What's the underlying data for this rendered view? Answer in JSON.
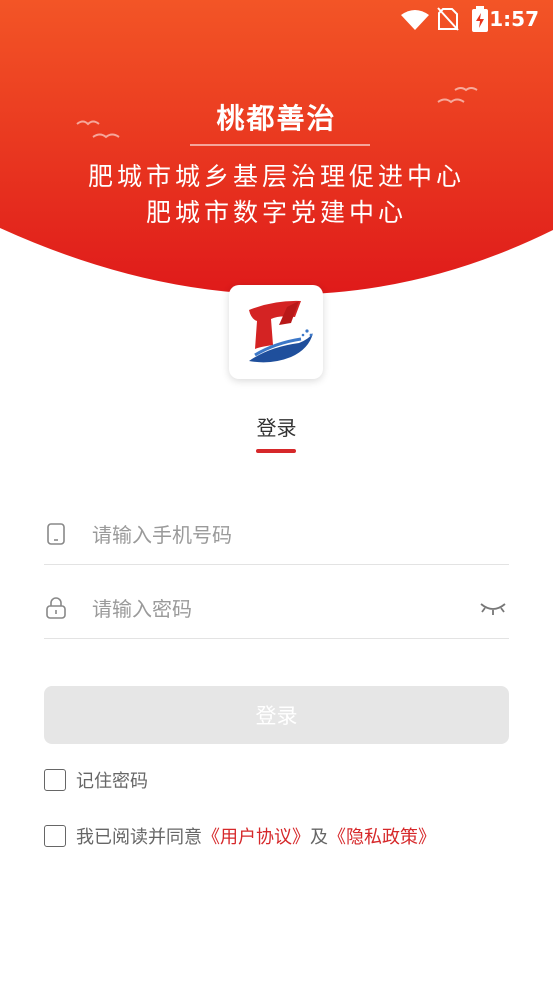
{
  "status_bar": {
    "time": "1:57"
  },
  "hero": {
    "title": "桃都善治",
    "subtitle_line1": "肥城市城乡基层治理促进中心",
    "subtitle_line2": "肥城市数字党建中心"
  },
  "tabs": {
    "login_label": "登录"
  },
  "form": {
    "phone": {
      "placeholder": "请输入手机号码",
      "value": ""
    },
    "password": {
      "placeholder": "请输入密码",
      "value": ""
    }
  },
  "login_button_label": "登录",
  "remember": {
    "label": "记住密码",
    "checked": false
  },
  "agreement": {
    "prefix": "我已阅读并同意",
    "user_agreement": "《用户协议》",
    "conjunction": "及",
    "privacy_policy": "《隐私政策》",
    "checked": false
  },
  "colors": {
    "primary_red": "#d6282a",
    "hero_red_light": "#f04a23",
    "hero_red_dark": "#e01b1b",
    "button_disabled": "#e6e6e6"
  },
  "icons": [
    "wifi-icon",
    "no-sim-icon",
    "battery-charging-icon",
    "phone-icon",
    "lock-icon",
    "eye-closed-icon",
    "app-logo"
  ]
}
